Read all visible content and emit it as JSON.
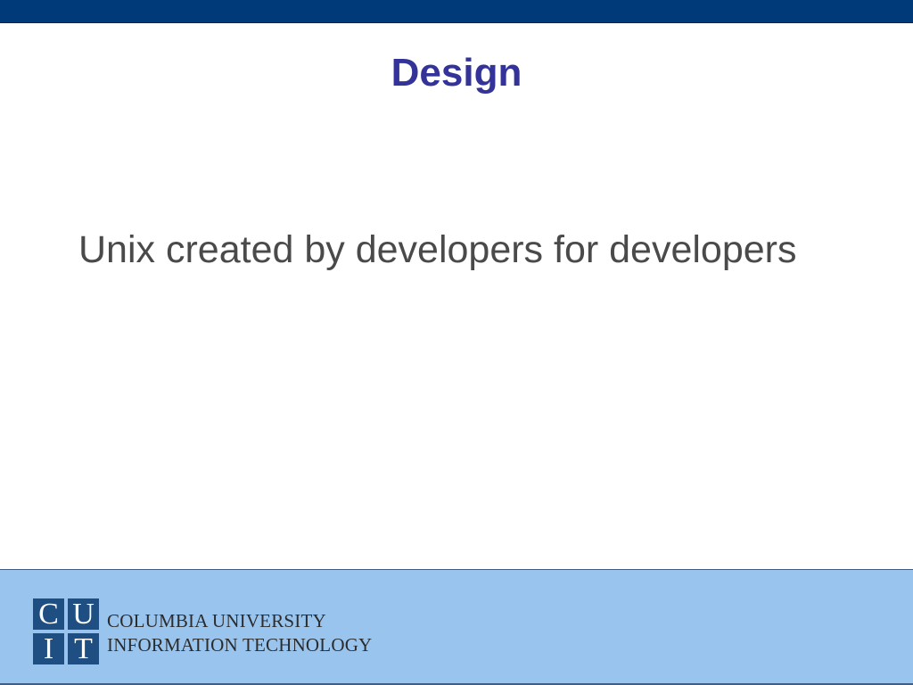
{
  "slide": {
    "title": "Design",
    "body": "Unix created by developers for developers"
  },
  "footer": {
    "logo": {
      "letters": [
        "C",
        "U",
        "I",
        "T"
      ]
    },
    "org_line1": "COLUMBIA UNIVERSITY",
    "org_line2": "INFORMATION TECHNOLOGY"
  },
  "colors": {
    "top_bar": "#003a78",
    "title": "#333399",
    "body_text": "#4a4a4a",
    "footer_bg": "#99c4ee",
    "logo_tile": "#1f4f82"
  }
}
